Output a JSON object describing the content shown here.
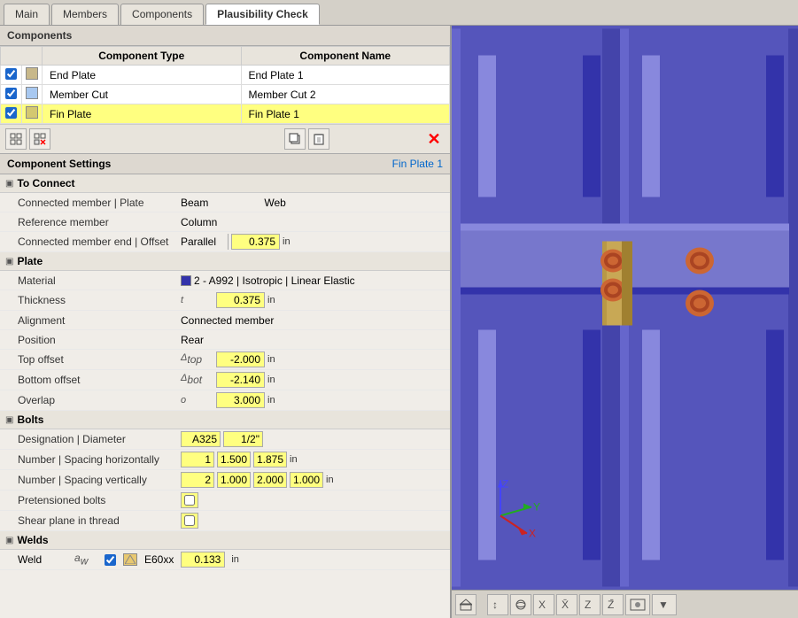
{
  "tabs": [
    {
      "id": "main",
      "label": "Main"
    },
    {
      "id": "members",
      "label": "Members"
    },
    {
      "id": "components",
      "label": "Components"
    },
    {
      "id": "plausibility",
      "label": "Plausibility Check"
    }
  ],
  "active_tab": "components",
  "components_title": "Components",
  "table": {
    "col1": "Component Type",
    "col2": "Component Name",
    "rows": [
      {
        "checked": true,
        "type": "End Plate",
        "name": "End Plate 1",
        "selected": false
      },
      {
        "checked": true,
        "type": "Member Cut",
        "name": "Member Cut 2",
        "selected": false
      },
      {
        "checked": true,
        "type": "Fin Plate",
        "name": "Fin Plate 1",
        "selected": true
      }
    ]
  },
  "toolbar": {
    "btn1": "⊞",
    "btn2": "⊟",
    "btn3": "⎘",
    "btn4": "⎗",
    "close": "✕"
  },
  "settings": {
    "title": "Component Settings",
    "subtitle": "Fin Plate 1",
    "groups": [
      {
        "label": "To Connect",
        "rows": [
          {
            "label": "Connected member | Plate",
            "symbol": "",
            "values": [
              "Beam",
              "Web"
            ]
          },
          {
            "label": "Reference member",
            "symbol": "",
            "values": [
              "Column"
            ]
          },
          {
            "label": "Connected member end | Offset",
            "symbol": "",
            "values": [
              "Parallel",
              "0.375",
              "in"
            ]
          }
        ]
      },
      {
        "label": "Plate",
        "rows": [
          {
            "label": "Material",
            "symbol": "",
            "values": [
              "mat",
              "2 - A992 | Isotropic | Linear Elastic"
            ]
          },
          {
            "label": "Thickness",
            "symbol": "t",
            "values": [
              "0.375",
              "in"
            ]
          },
          {
            "label": "Alignment",
            "symbol": "",
            "values": [
              "Connected member"
            ]
          },
          {
            "label": "Position",
            "symbol": "",
            "values": [
              "Rear"
            ]
          },
          {
            "label": "Top offset",
            "symbol": "Δtop",
            "values": [
              "-2.000",
              "in"
            ]
          },
          {
            "label": "Bottom offset",
            "symbol": "Δbot",
            "values": [
              "-2.140",
              "in"
            ]
          },
          {
            "label": "Overlap",
            "symbol": "o",
            "values": [
              "3.000",
              "in"
            ]
          }
        ]
      },
      {
        "label": "Bolts",
        "rows": [
          {
            "label": "Designation | Diameter",
            "symbol": "",
            "values": [
              "A325",
              "1/2\""
            ]
          },
          {
            "label": "Number | Spacing horizontally",
            "symbol": "",
            "values": [
              "1",
              "1.500",
              "1.875",
              "in"
            ]
          },
          {
            "label": "Number | Spacing vertically",
            "symbol": "",
            "values": [
              "2",
              "1.000",
              "2.000",
              "1.000",
              "in"
            ]
          },
          {
            "label": "Pretensioned bolts",
            "symbol": "",
            "values": [
              "checkbox_empty"
            ]
          },
          {
            "label": "Shear plane in thread",
            "symbol": "",
            "values": [
              "checkbox_empty"
            ]
          }
        ]
      },
      {
        "label": "Welds",
        "rows": [
          {
            "label": "Weld",
            "symbol": "aw",
            "values": [
              "checkbox_checked",
              "E60xx",
              "0.133",
              "in"
            ]
          }
        ]
      }
    ]
  }
}
